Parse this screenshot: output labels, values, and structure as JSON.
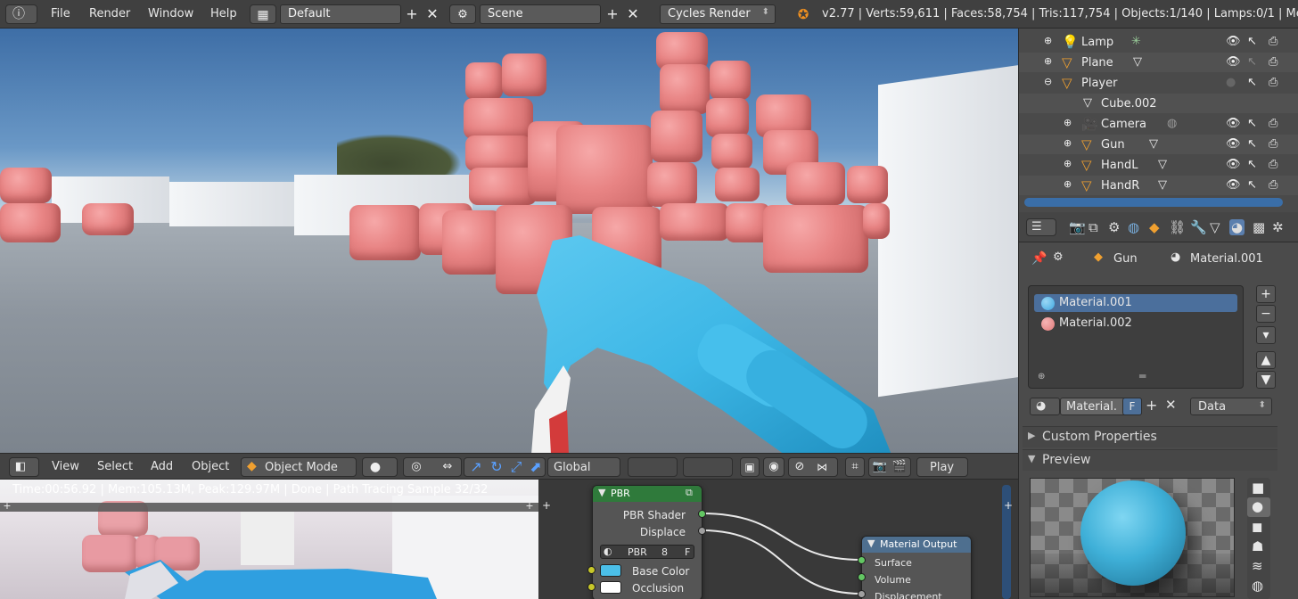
{
  "topbar": {
    "menus": [
      "File",
      "Render",
      "Window",
      "Help"
    ],
    "screen_layout": "Default",
    "scene": "Scene",
    "engine": "Cycles Render",
    "stats": "v2.77 | Verts:59,611 | Faces:58,754 | Tris:117,754 | Objects:1/140 | Lamps:0/1 | Mem:2"
  },
  "viewport_header": {
    "menus": [
      "View",
      "Select",
      "Add",
      "Object"
    ],
    "mode": "Object Mode",
    "orientation": "Global",
    "play_label": "Play"
  },
  "render_preview": {
    "status": "Time:00:56.92 | Mem:105.13M, Peak:129.97M | Done | Path Tracing Sample 32/32"
  },
  "node_editor": {
    "pbr_node": {
      "title": "PBR",
      "outputs": [
        "PBR Shader",
        "Displace"
      ],
      "group_name": "PBR",
      "group_users": "8",
      "fake_user": "F",
      "inputs": [
        "Base Color",
        "Occlusion"
      ]
    },
    "output_node": {
      "title": "Material Output",
      "inputs": [
        "Surface",
        "Volume",
        "Displacement"
      ]
    }
  },
  "outliner": {
    "rows": [
      {
        "label": "Lamp"
      },
      {
        "label": "Plane"
      },
      {
        "label": "Player"
      },
      {
        "label": "Cube.002"
      },
      {
        "label": "Camera"
      },
      {
        "label": "Gun"
      },
      {
        "label": "HandL"
      },
      {
        "label": "HandR"
      }
    ]
  },
  "properties": {
    "breadcrumb_object": "Gun",
    "breadcrumb_material": "Material.001",
    "material_slots": [
      {
        "name": "Material.001",
        "color": "#3fa7e0",
        "selected": true
      },
      {
        "name": "Material.002",
        "color": "#e07a7a",
        "selected": false
      }
    ],
    "material_field": "Material.",
    "fake_user": "F",
    "link_mode": "Data",
    "sections": [
      "Custom Properties",
      "Preview"
    ]
  },
  "colors": {
    "gun_blue": "#3db7e6",
    "cube_pink": "#e88484",
    "selection_blue": "#4b6f9c"
  }
}
